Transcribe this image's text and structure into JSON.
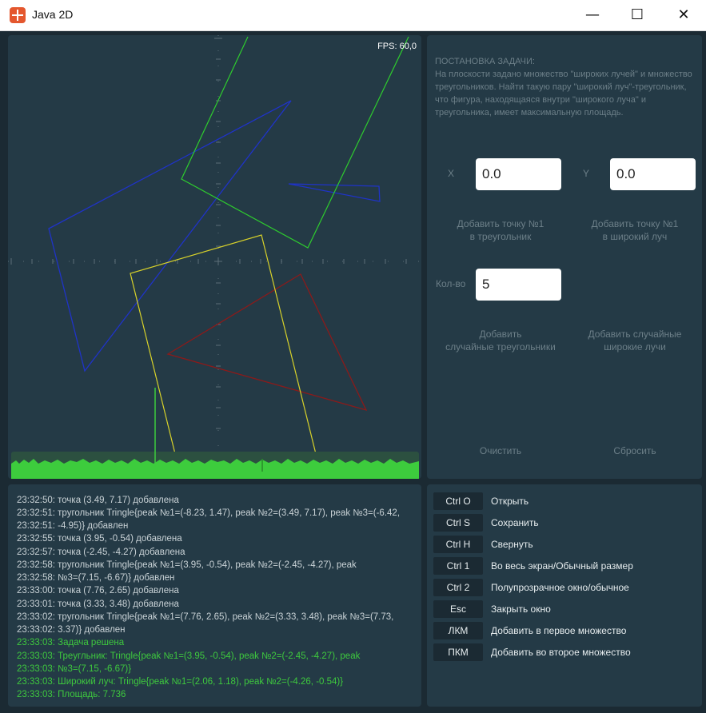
{
  "window": {
    "title": "Java 2D",
    "minimize": "—",
    "maximize": "☐",
    "close": "✕"
  },
  "canvas": {
    "fps": "FPS: 60,0"
  },
  "task": {
    "heading": "ПОСТАНОВКА ЗАДАЧИ:",
    "text": "На плоскости задано множество \"широких лучей\" и множество треугольников. Найти такую пару \"широкий луч\"-треугольник, что фигура, находящаяся внутри \"широкого луча\" и треугольника, имеет максимальную площадь.",
    "x_label": "X",
    "y_label": "Y",
    "x_value": "0.0",
    "y_value": "0.0",
    "add_triangle_point_line1": "Добавить точку №1",
    "add_triangle_point_line2": "в треугольник",
    "add_ray_point_line1": "Добавить точку №1",
    "add_ray_point_line2": "в широкий луч",
    "count_label": "Кол-во",
    "count_value": "5",
    "add_random_triangles_line1": "Добавить",
    "add_random_triangles_line2": "случайные треугольники",
    "add_random_rays_line1": "Добавить случайные",
    "add_random_rays_line2": "широкие лучи",
    "clear_label": "Очистить",
    "reset_label": "Сбросить"
  },
  "log": [
    {
      "text": "23:32:50: точка (3.49, 7.17) добавлена",
      "ok": false
    },
    {
      "text": "23:32:51: тругольник Tringle{peak №1=(-8.23, 1.47), peak №2=(3.49, 7.17), peak №3=(-6.42,",
      "ok": false
    },
    {
      "text": "23:32:51: -4.95)} добавлен",
      "ok": false
    },
    {
      "text": "23:32:55: точка (3.95, -0.54) добавлена",
      "ok": false
    },
    {
      "text": "23:32:57: точка (-2.45, -4.27) добавлена",
      "ok": false
    },
    {
      "text": "23:32:58: тругольник Tringle{peak №1=(3.95, -0.54), peak №2=(-2.45, -4.27), peak",
      "ok": false
    },
    {
      "text": "23:32:58: №3=(7.15, -6.67)} добавлен",
      "ok": false
    },
    {
      "text": "23:33:00: точка (7.76, 2.65) добавлена",
      "ok": false
    },
    {
      "text": "23:33:01: точка (3.33, 3.48) добавлена",
      "ok": false
    },
    {
      "text": "23:33:02: тругольник Tringle{peak №1=(7.76, 2.65), peak №2=(3.33, 3.48), peak №3=(7.73,",
      "ok": false
    },
    {
      "text": "23:33:02: 3.37)} добавлен",
      "ok": false
    },
    {
      "text": "23:33:03: Задача решена",
      "ok": true
    },
    {
      "text": "23:33:03: Треугльник: Tringle{peak №1=(3.95, -0.54), peak №2=(-2.45, -4.27), peak",
      "ok": true
    },
    {
      "text": "23:33:03: №3=(7.15, -6.67)}",
      "ok": true
    },
    {
      "text": "23:33:03: Широкий луч: Tringle{peak №1=(2.06, 1.18), peak №2=(-4.26, -0.54)}",
      "ok": true
    },
    {
      "text": "23:33:03: Площадь: 7.736",
      "ok": true
    }
  ],
  "hotkeys": [
    {
      "key": "Ctrl O",
      "desc": "Открыть"
    },
    {
      "key": "Ctrl S",
      "desc": "Сохранить"
    },
    {
      "key": "Ctrl H",
      "desc": "Свернуть"
    },
    {
      "key": "Ctrl 1",
      "desc": "Во весь экран/Обычный размер"
    },
    {
      "key": "Ctrl 2",
      "desc": "Полупрозрачное окно/обычное"
    },
    {
      "key": "Esc",
      "desc": "Закрыть окно"
    },
    {
      "key": "ЛКМ",
      "desc": "Добавить в первое множество"
    },
    {
      "key": "ПКМ",
      "desc": "Добавить во второе множество"
    }
  ],
  "colors": {
    "background": "#1b2a33",
    "panel": "#243a46",
    "triangle_blue": "#1f33c8",
    "triangle_red": "#8b1a1a",
    "ray_green": "#2ecc2e",
    "ray_yellow": "#d8d22a",
    "log_ok": "#3ec93e",
    "fps_bar": "#3dcc3d"
  }
}
